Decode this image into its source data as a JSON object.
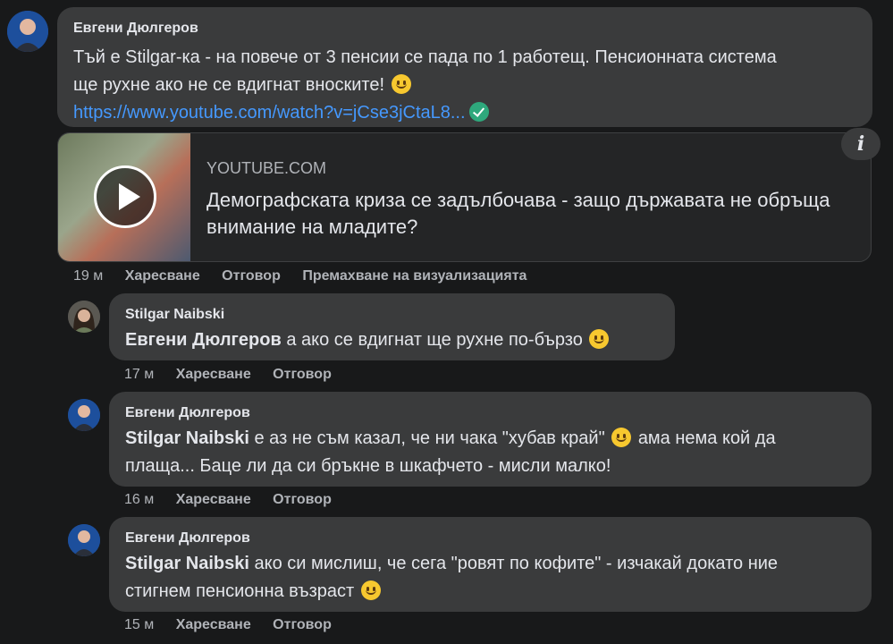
{
  "comments": [
    {
      "author": "Евгени Дюлгеров",
      "avatar_icon": "user-avatar-blue",
      "line1": "Тъй е Stilgar-ка - на повече от 3 пенсии се пада по 1 работещ. Пенсионната система",
      "line2": "ще рухне ако не се вдигнат вноските!",
      "link_text": "https://www.youtube.com/watch?v=jCse3jCtaL8...",
      "preview": {
        "source": "YOUTUBE.COM",
        "title": "Демографската криза се задълбочава - защо държавата не обръща внимание на младите?"
      },
      "time": "19 м",
      "like": "Харесване",
      "reply": "Отговор",
      "remove_preview": "Премахване на визуализацията"
    },
    {
      "author": "Stilgar Naibski",
      "avatar_icon": "user-avatar-woman",
      "mention": "Евгени Дюлгеров",
      "line1": "а ако се вдигнат ще рухне по-бързо",
      "time": "17 м",
      "like": "Харесване",
      "reply": "Отговор"
    },
    {
      "author": "Евгени Дюлгеров",
      "avatar_icon": "user-avatar-blue",
      "mention": "Stilgar Naibski",
      "line1a": "е аз не съм казал, че ни чака \"хубав край\"",
      "line1b": "ама нема кой да",
      "line2": "плаща... Баце ли да си бръкне в шкафчето - мисли малко!",
      "time": "16 м",
      "like": "Харесване",
      "reply": "Отговор"
    },
    {
      "author": "Евгени Дюлгеров",
      "avatar_icon": "user-avatar-blue",
      "mention": "Stilgar Naibski",
      "line1": "ако си мислиш, че сега \"ровят по кофите\" - изчакай докато ние",
      "line2": "стигнем пенсионна възраст",
      "time": "15 м",
      "like": "Харесване",
      "reply": "Отговор"
    }
  ],
  "info_icon_label": "i",
  "colors": {
    "background": "#18191a",
    "bubble": "#3a3b3c",
    "link": "#4599ff",
    "verified": "#2ea87c"
  }
}
